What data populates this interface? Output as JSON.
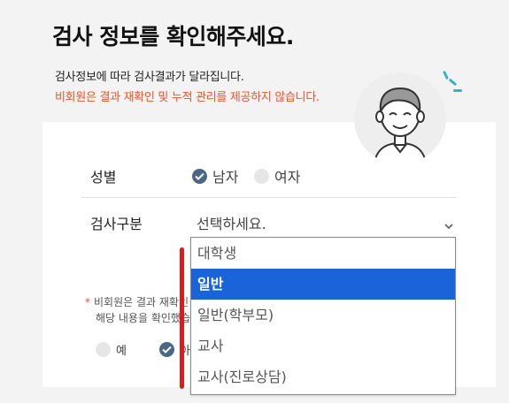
{
  "page": {
    "title": "검사 정보를 확인해주세요.",
    "subtitle": "검사정보에 따라 검사결과가 달라집니다.",
    "warning": "비회원은 결과 재확인 및 누적 관리를 제공하지 않습니다."
  },
  "form": {
    "gender": {
      "label": "성별",
      "options": [
        {
          "label": "남자",
          "selected": true
        },
        {
          "label": "여자",
          "selected": false
        }
      ]
    },
    "test_type": {
      "label": "검사구분",
      "placeholder": "선택하세요.",
      "options": [
        "대학생",
        "일반",
        "일반(학부모)",
        "교사",
        "교사(진로상담)"
      ],
      "highlighted_index": 1
    }
  },
  "notice": {
    "asterisk": "*",
    "line1": "비회원은 결과 재확인",
    "line2": "해당 내용을 확인했습"
  },
  "agreement": {
    "options": [
      {
        "label": "예",
        "selected": false
      },
      {
        "label": "아",
        "selected": true
      }
    ]
  },
  "colors": {
    "accent": "#4a6788",
    "warning": "#e8532c",
    "highlight": "#1a63d8",
    "annotation": "#e0191b"
  },
  "icons": [
    "avatar-icon",
    "check-icon",
    "chevron-down-icon"
  ]
}
